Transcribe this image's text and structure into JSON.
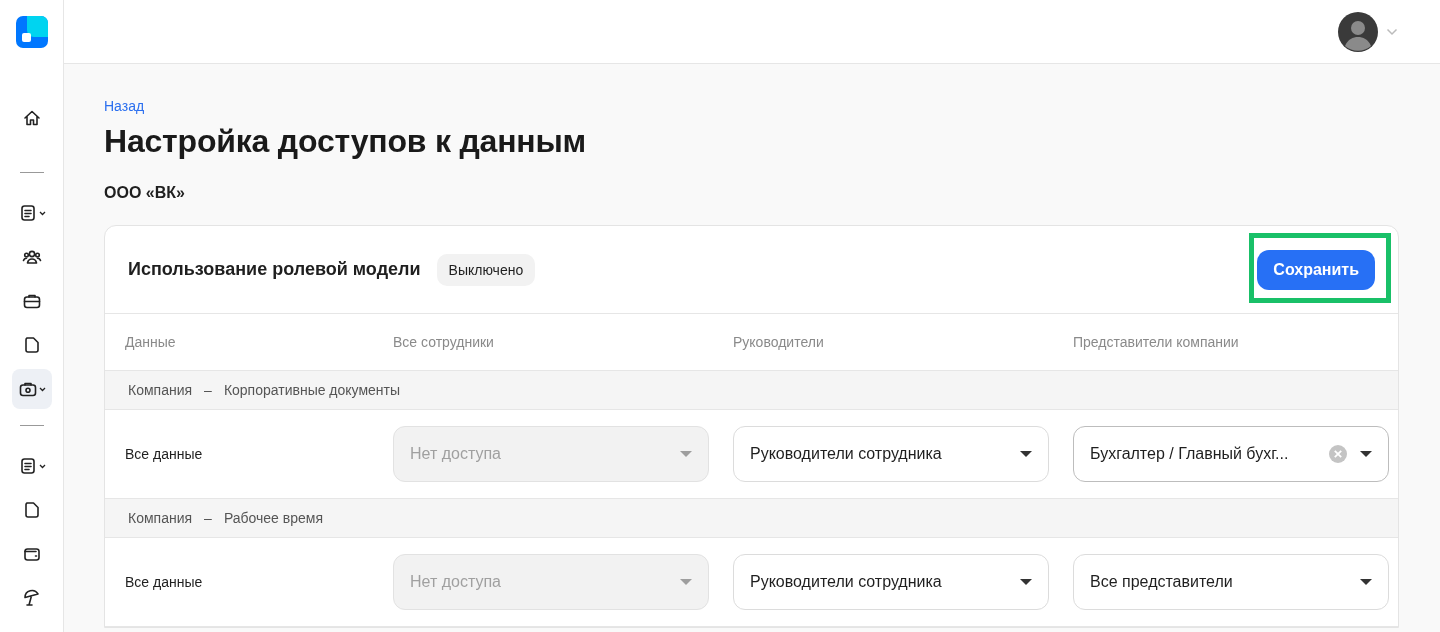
{
  "sidebar": {
    "groups": [
      {
        "items": [
          {
            "selected": false,
            "expandable": false
          }
        ]
      },
      {
        "items": [
          {
            "selected": false,
            "expandable": true
          },
          {
            "selected": false,
            "expandable": false
          },
          {
            "selected": false,
            "expandable": false
          },
          {
            "selected": false,
            "expandable": false
          },
          {
            "selected": true,
            "expandable": true
          }
        ]
      },
      {
        "items": [
          {
            "selected": false,
            "expandable": true
          },
          {
            "selected": false,
            "expandable": false
          },
          {
            "selected": false,
            "expandable": false
          },
          {
            "selected": false,
            "expandable": false
          }
        ]
      }
    ]
  },
  "back_link": "Назад",
  "title": "Настройка доступов к данным",
  "company": "ООО «ВК»",
  "card": {
    "title": "Использование ролевой модели",
    "status": "Выключено",
    "save_button": {
      "label": "Сохранить",
      "highlighted": true
    },
    "columns": [
      "Данные",
      "Все сотрудники",
      "Руководители",
      "Представители компании"
    ],
    "groups": [
      {
        "category": "Компания",
        "separator": "–",
        "name": "Корпоративные документы",
        "rows": [
          {
            "label": "Все данные",
            "cells": [
              {
                "value": "Нет доступа",
                "disabled": true,
                "clearable": false
              },
              {
                "value": "Руководители сотрудника",
                "disabled": false,
                "clearable": false
              },
              {
                "value": "Бухгалтер / Главный бухг...",
                "disabled": false,
                "clearable": true
              }
            ]
          }
        ]
      },
      {
        "category": "Компания",
        "separator": "–",
        "name": "Рабочее время",
        "rows": [
          {
            "label": "Все данные",
            "cells": [
              {
                "value": "Нет доступа",
                "disabled": true,
                "clearable": false
              },
              {
                "value": "Руководители сотрудника",
                "disabled": false,
                "clearable": false
              },
              {
                "value": "Все представители",
                "disabled": false,
                "clearable": false
              }
            ]
          }
        ]
      }
    ]
  }
}
